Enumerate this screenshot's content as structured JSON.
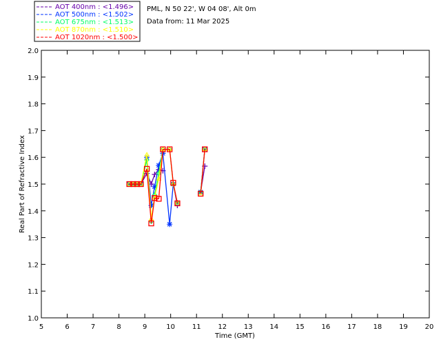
{
  "header": {
    "site": "PML, N 50 22', W 04 08', Alt 0m",
    "date": "Data from: 11 Mar 2025"
  },
  "chart_data": {
    "type": "line",
    "title": "",
    "xlabel": "Time (GMT)",
    "ylabel": "Real Part of Refractive Index",
    "xlim": [
      5,
      20
    ],
    "ylim": [
      1.0,
      2.0
    ],
    "xticks": [
      5,
      6,
      7,
      8,
      9,
      10,
      11,
      12,
      13,
      14,
      15,
      16,
      17,
      18,
      19,
      20
    ],
    "yticks": [
      "1.0",
      "1.1",
      "1.2",
      "1.3",
      "1.4",
      "1.5",
      "1.6",
      "1.7",
      "1.8",
      "1.9",
      "2.0"
    ],
    "grid": false,
    "legend_position": "top-left",
    "x": [
      8.4,
      8.55,
      8.7,
      8.85,
      9.08,
      9.25,
      9.38,
      9.54,
      9.7,
      9.96,
      10.1,
      10.26,
      11.16,
      11.32
    ],
    "series": [
      {
        "name": "AOT  400nm : <1.496>",
        "color": "#6600aa",
        "marker": "plus",
        "values": [
          1.5,
          1.5,
          1.5,
          1.5,
          1.54,
          1.5,
          1.536,
          1.554,
          1.55,
          null,
          1.5,
          1.42,
          1.47,
          1.567
        ]
      },
      {
        "name": "AOT  500nm : <1.502>",
        "color": "#0033ff",
        "marker": "asterisk",
        "values": [
          1.5,
          1.5,
          1.5,
          1.5,
          1.6,
          1.42,
          1.49,
          1.57,
          1.615,
          1.35,
          1.5,
          1.43,
          1.47,
          1.63
        ]
      },
      {
        "name": "AOT  675nm : <1.513>",
        "color": "#00ff66",
        "marker": "diamond",
        "values": [
          1.5,
          1.5,
          1.5,
          1.5,
          1.59,
          1.36,
          1.46,
          1.54,
          1.63,
          1.63,
          1.5,
          1.43,
          1.47,
          1.63
        ]
      },
      {
        "name": "AOT  870nm : <1.510>",
        "color": "#ffff00",
        "marker": "triangle",
        "values": [
          1.5,
          1.5,
          1.5,
          1.5,
          1.61,
          1.37,
          1.45,
          1.52,
          1.63,
          1.63,
          1.5,
          1.43,
          1.46,
          1.63
        ]
      },
      {
        "name": "AOT 1020nm : <1.500>",
        "color": "#ff0000",
        "marker": "square",
        "values": [
          1.5,
          1.5,
          1.5,
          1.5,
          1.557,
          1.353,
          1.448,
          1.445,
          1.63,
          1.63,
          1.505,
          1.428,
          1.464,
          1.63
        ]
      }
    ]
  }
}
